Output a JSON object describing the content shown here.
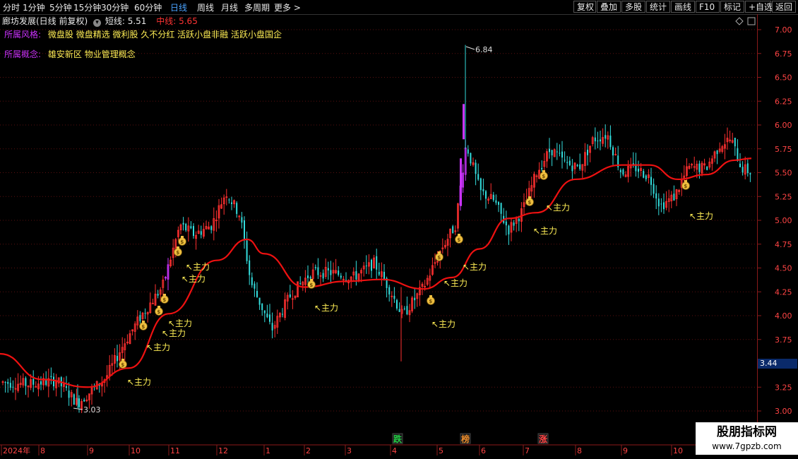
{
  "toolbar": {
    "periods": [
      "分时",
      "1分钟",
      "5分钟",
      "15分钟",
      "30分钟",
      "60分钟",
      "日线",
      "周线",
      "月线",
      "多周期",
      "更多 >"
    ],
    "active_period": "日线",
    "buttons": [
      "复权",
      "叠加",
      "多股",
      "统计",
      "画线",
      "F10",
      "标记",
      "+自选",
      "返回"
    ]
  },
  "info": {
    "stock": "廊坊发展(日线 前复权)",
    "short_label": "短线: 5.51",
    "mid_label": "中线: 5.65",
    "style_label": "所属风格:",
    "style_value": "微盘股 微盘精选 微利股 久不分红 活跃小盘非融 活跃小盘国企",
    "concept_label": "所属概念:",
    "concept_value": "雄安新区 物业管理概念"
  },
  "price_axis": [
    "7.00",
    "6.75",
    "6.50",
    "6.25",
    "6.00",
    "5.75",
    "5.50",
    "5.25",
    "5.00",
    "4.75",
    "4.50",
    "4.25",
    "4.00",
    "3.75",
    "3.25",
    "3.00"
  ],
  "current_price": "3.44",
  "time_axis": [
    "2024年",
    "8",
    "9",
    "10",
    "11",
    "12",
    "1",
    "2",
    "3",
    "4",
    "5",
    "6",
    "7",
    "8",
    "9",
    "10"
  ],
  "annotations": {
    "high": "6.84",
    "low": "3.03",
    "zhuli": "主力",
    "markers": [
      {
        "text": "跌",
        "color": "#22cc44"
      },
      {
        "text": "榜",
        "color": "#e88a2a"
      },
      {
        "text": "涨",
        "color": "#ff4444"
      }
    ]
  },
  "brand": {
    "name": "股朋指标网",
    "url": "www.7gpzb.com"
  },
  "colors": {
    "up": "#ff3030",
    "down": "#33dddd",
    "ma": "#ee1111",
    "special": "#cc33ff",
    "label_yellow": "#ffee55",
    "axis": "#8b1a1a"
  },
  "chart_data": {
    "type": "candlestick",
    "y_axis_range": [
      3.0,
      7.0
    ],
    "ma_line": [
      {
        "date": "2024-07",
        "value": 3.6
      },
      {
        "date": "2024-08",
        "value": 3.33
      },
      {
        "date": "2024-09",
        "value": 3.25
      },
      {
        "date": "2024-10",
        "value": 3.45
      },
      {
        "date": "2024-11",
        "value": 4.02
      },
      {
        "date": "2024-12",
        "value": 4.58
      },
      {
        "date": "2025-01",
        "value": 4.65
      },
      {
        "date": "2025-02",
        "value": 4.3
      },
      {
        "date": "2025-03",
        "value": 4.36
      },
      {
        "date": "2025-04",
        "value": 4.3
      },
      {
        "date": "2025-05",
        "value": 4.48
      },
      {
        "date": "2025-06",
        "value": 5.02
      },
      {
        "date": "2025-07",
        "value": 5.1
      },
      {
        "date": "2025-08",
        "value": 5.43
      },
      {
        "date": "2025-09",
        "value": 5.58
      },
      {
        "date": "2025-10",
        "value": 5.43
      },
      {
        "date": "2025-11",
        "value": 5.65
      }
    ],
    "extremes": {
      "high": 6.84,
      "low": 3.03
    },
    "current_price": 3.44
  }
}
